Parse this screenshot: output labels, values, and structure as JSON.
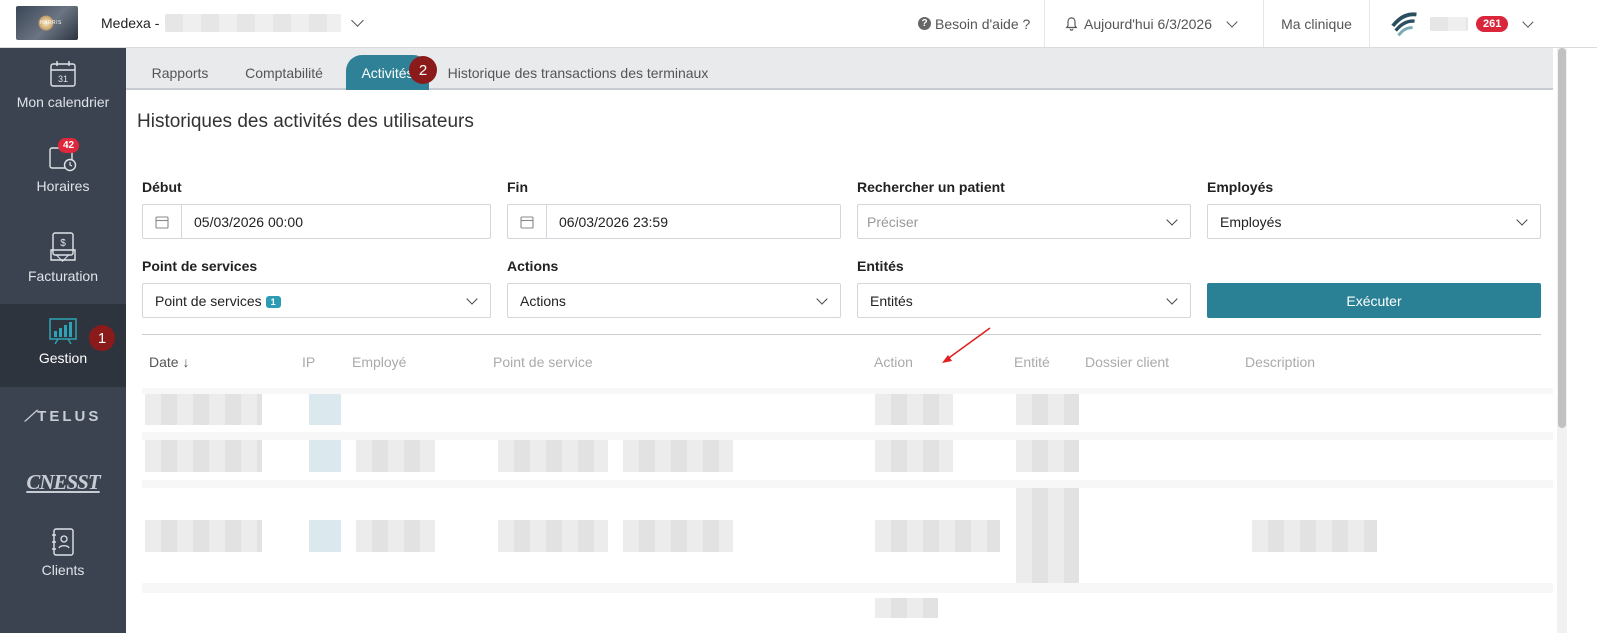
{
  "topbar": {
    "logo_text": "HARRIS",
    "app_name": "Medexa -",
    "help_label": "Besoin d'aide ?",
    "today_label": "Aujourd'hui 6/3/2026",
    "my_clinic_label": "Ma clinique",
    "user_badge": "261"
  },
  "sidebar": {
    "items": [
      {
        "label": "Mon calendrier",
        "icon": "calendar-icon",
        "icon_text": "31"
      },
      {
        "label": "Horaires",
        "icon": "schedule-icon",
        "badge": "42"
      },
      {
        "label": "Facturation",
        "icon": "billing-icon"
      },
      {
        "label": "Gestion",
        "icon": "management-chart-icon",
        "active": true,
        "step": "1"
      },
      {
        "label": "Clients",
        "icon": "clients-icon"
      }
    ],
    "brands": [
      "TELUS",
      "CNESST"
    ]
  },
  "tabs": [
    {
      "label": "Rapports"
    },
    {
      "label": "Comptabilité"
    },
    {
      "label": "Activités",
      "active": true,
      "step": "2"
    },
    {
      "label": "Historique des transactions des terminaux"
    }
  ],
  "page_title": "Historiques des activités des utilisateurs",
  "filters": {
    "start": {
      "label": "Début",
      "value": "05/03/2026 00:00"
    },
    "end": {
      "label": "Fin",
      "value": "06/03/2026 23:59"
    },
    "patient": {
      "label": "Rechercher un patient",
      "placeholder": "Préciser"
    },
    "employees": {
      "label": "Employés",
      "value": "Employés"
    },
    "service_point": {
      "label": "Point de services",
      "value": "Point de services",
      "count": "1"
    },
    "actions": {
      "label": "Actions",
      "value": "Actions"
    },
    "entities": {
      "label": "Entités",
      "value": "Entités"
    },
    "execute_label": "Exécuter"
  },
  "table": {
    "columns": [
      "Date",
      "IP",
      "Employé",
      "Point de service",
      "Action",
      "Entité",
      "Dossier client",
      "Description"
    ]
  },
  "colors": {
    "accent": "#2a8196",
    "sidebar_bg": "#3c4350",
    "step_badge": "#8b1a1a",
    "annotation_arrow": "#e02020"
  }
}
